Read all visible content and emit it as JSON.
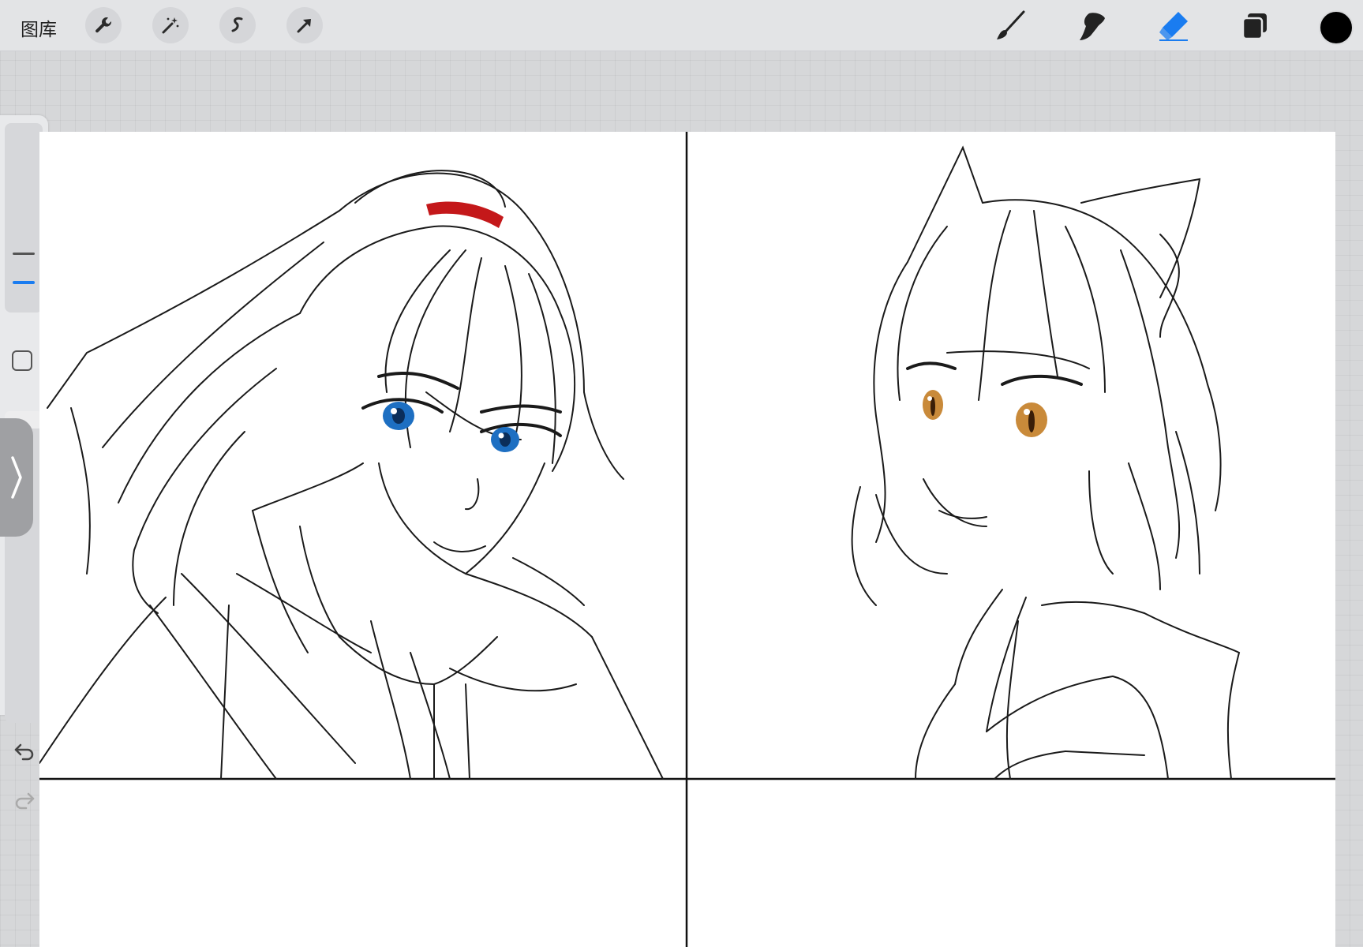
{
  "topbar": {
    "gallery_label": "图库",
    "left_tools": [
      {
        "name": "wrench-icon",
        "tool": "actions"
      },
      {
        "name": "magic-wand-icon",
        "tool": "adjustments"
      },
      {
        "name": "selection-icon",
        "tool": "selection"
      },
      {
        "name": "transform-arrow-icon",
        "tool": "transform"
      }
    ],
    "right_tools": [
      {
        "name": "brush-icon",
        "tool": "paint"
      },
      {
        "name": "smudge-icon",
        "tool": "smudge"
      },
      {
        "name": "eraser-icon",
        "tool": "erase",
        "active": true
      },
      {
        "name": "layers-icon",
        "tool": "layers"
      }
    ],
    "current_color": "#000000"
  },
  "sidebar": {
    "brush_size_icon": "size-slider",
    "opacity_icon": "opacity-slider",
    "modifier_icon": "square-modifier-icon",
    "collapse_icon": "chevron-right-icon",
    "undo_icon": "undo-icon",
    "redo_icon": "redo-icon"
  },
  "colors": {
    "accent": "#1a7cf0",
    "hair_tie": "#c4181a",
    "left_eye": "#1d6fc2",
    "right_eye": "#c98a3a",
    "toolbar_bg": "#e3e4e6",
    "workspace_bg": "#d6d7d9"
  }
}
